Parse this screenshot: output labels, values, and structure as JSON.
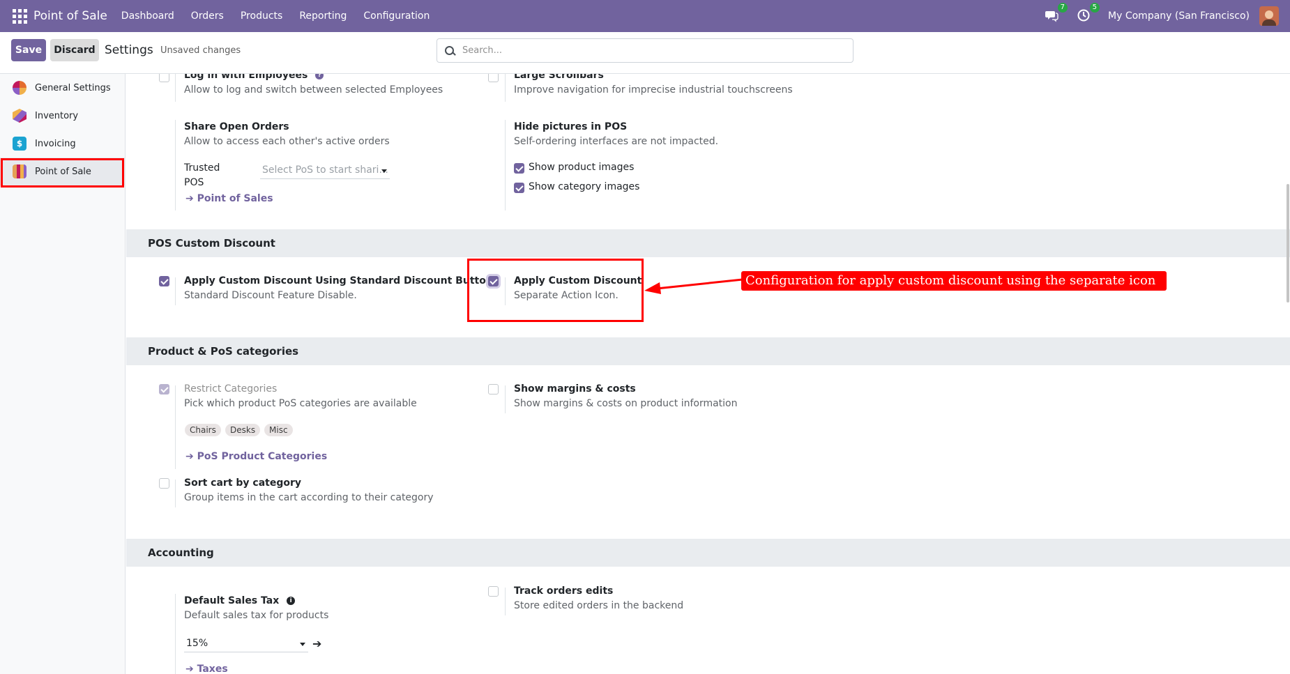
{
  "navbar": {
    "app_title": "Point of Sale",
    "menu": [
      "Dashboard",
      "Orders",
      "Products",
      "Reporting",
      "Configuration"
    ],
    "messages_count": "7",
    "activities_count": "5",
    "company": "My Company (San Francisco)"
  },
  "controlbar": {
    "save_label": "Save",
    "discard_label": "Discard",
    "title": "Settings",
    "status": "Unsaved changes",
    "search_placeholder": "Search..."
  },
  "sidebar": {
    "items": [
      {
        "label": "General Settings",
        "icon": "general-settings-icon"
      },
      {
        "label": "Inventory",
        "icon": "inventory-icon"
      },
      {
        "label": "Invoicing",
        "icon": "invoicing-icon"
      },
      {
        "label": "Point of Sale",
        "icon": "point-of-sale-icon",
        "active": true
      }
    ]
  },
  "settings": {
    "log_in_employees": {
      "title": "Log in with Employees",
      "desc": "Allow to log and switch between selected Employees",
      "checked": false
    },
    "large_scrollbars": {
      "title": "Large Scrollbars",
      "desc": "Improve navigation for imprecise industrial touchscreens",
      "checked": false
    },
    "share_open_orders": {
      "title": "Share Open Orders",
      "desc": "Allow to access each other's active orders",
      "trusted_label_1": "Trusted",
      "trusted_label_2": "POS",
      "trusted_placeholder": "Select PoS to start shari...",
      "link": "Point of Sales"
    },
    "hide_pictures": {
      "title": "Hide pictures in POS",
      "desc": "Self-ordering interfaces are not impacted.",
      "show_product_images": "Show product images",
      "show_category_images": "Show category images"
    },
    "custom_discount_section": "POS Custom Discount",
    "apply_standard": {
      "title": "Apply Custom Discount Using Standard Discount Button",
      "desc": "Standard Discount Feature Disable.",
      "checked": true
    },
    "apply_custom": {
      "title": "Apply Custom Discount",
      "desc": "Separate Action Icon.",
      "checked": true
    },
    "categories_section": "Product & PoS categories",
    "restrict_categories": {
      "title": "Restrict Categories",
      "desc": "Pick which product PoS categories are available",
      "tags": [
        "Chairs",
        "Desks",
        "Misc"
      ],
      "link": "PoS Product Categories",
      "checked": true
    },
    "show_margins": {
      "title": "Show margins & costs",
      "desc": "Show margins & costs on product information",
      "checked": false
    },
    "sort_cart": {
      "title": "Sort cart by category",
      "desc": "Group items in the cart according to their category",
      "checked": false
    },
    "accounting_section": "Accounting",
    "default_sales_tax": {
      "title": "Default Sales Tax",
      "desc": "Default sales tax for products",
      "value": "15%",
      "link": "Taxes"
    },
    "track_orders": {
      "title": "Track orders edits",
      "desc": "Store edited orders in the backend",
      "checked": false
    }
  },
  "annotation": {
    "text": "Configuration for apply custom discount using the separate icon",
    "color": "#ff0000"
  },
  "colors": {
    "brand": "#71639e",
    "section_bg": "#e9ecef",
    "highlight": "#ff0000"
  }
}
